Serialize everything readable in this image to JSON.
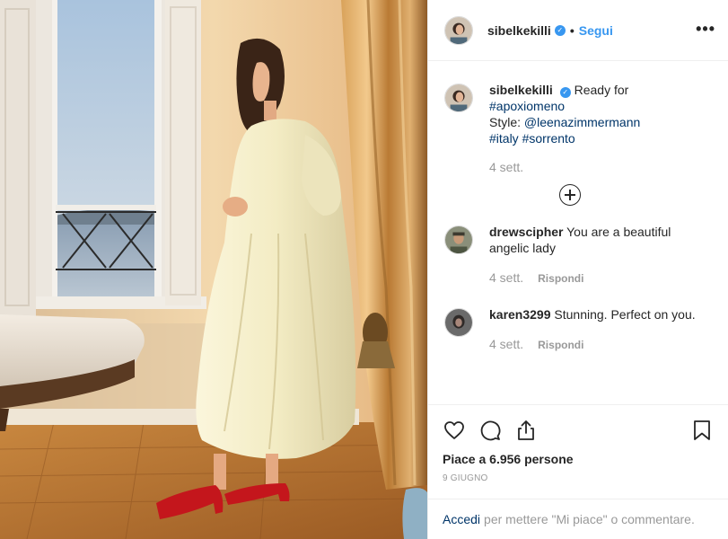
{
  "post": {
    "username": "sibelkekilli",
    "verified_mark": "✓",
    "separator": "•",
    "follow_label": "Segui",
    "more_label": "•••"
  },
  "caption": {
    "username": "sibelkekilli",
    "text_prefix": "Ready for",
    "tag1": "#apoxiomeno",
    "style_prefix": "Style:",
    "mention": "@leenazimmermann",
    "tag2": "#italy",
    "tag3": "#sorrento",
    "time": "4 sett."
  },
  "comments": [
    {
      "username": "drewscipher",
      "text": "You are a beautiful angelic lady",
      "time": "4 sett.",
      "reply": "Rispondi"
    },
    {
      "username": "karen3299",
      "text": "Stunning. Perfect on you.",
      "time": "4 sett.",
      "reply": "Rispondi"
    }
  ],
  "actions": {
    "icons": [
      "heart-icon",
      "comment-icon",
      "share-icon",
      "bookmark-icon"
    ],
    "likes_text": "Piace a 6.956 persone",
    "date": "9 GIUGNO"
  },
  "login": {
    "link": "Accedi",
    "rest": "per mettere \"Mi piace\" o commentare."
  },
  "colors": {
    "link_blue": "#3897f0",
    "hashtag": "#003569",
    "muted": "#999999",
    "dress_red_shoes": "#c4161c"
  }
}
